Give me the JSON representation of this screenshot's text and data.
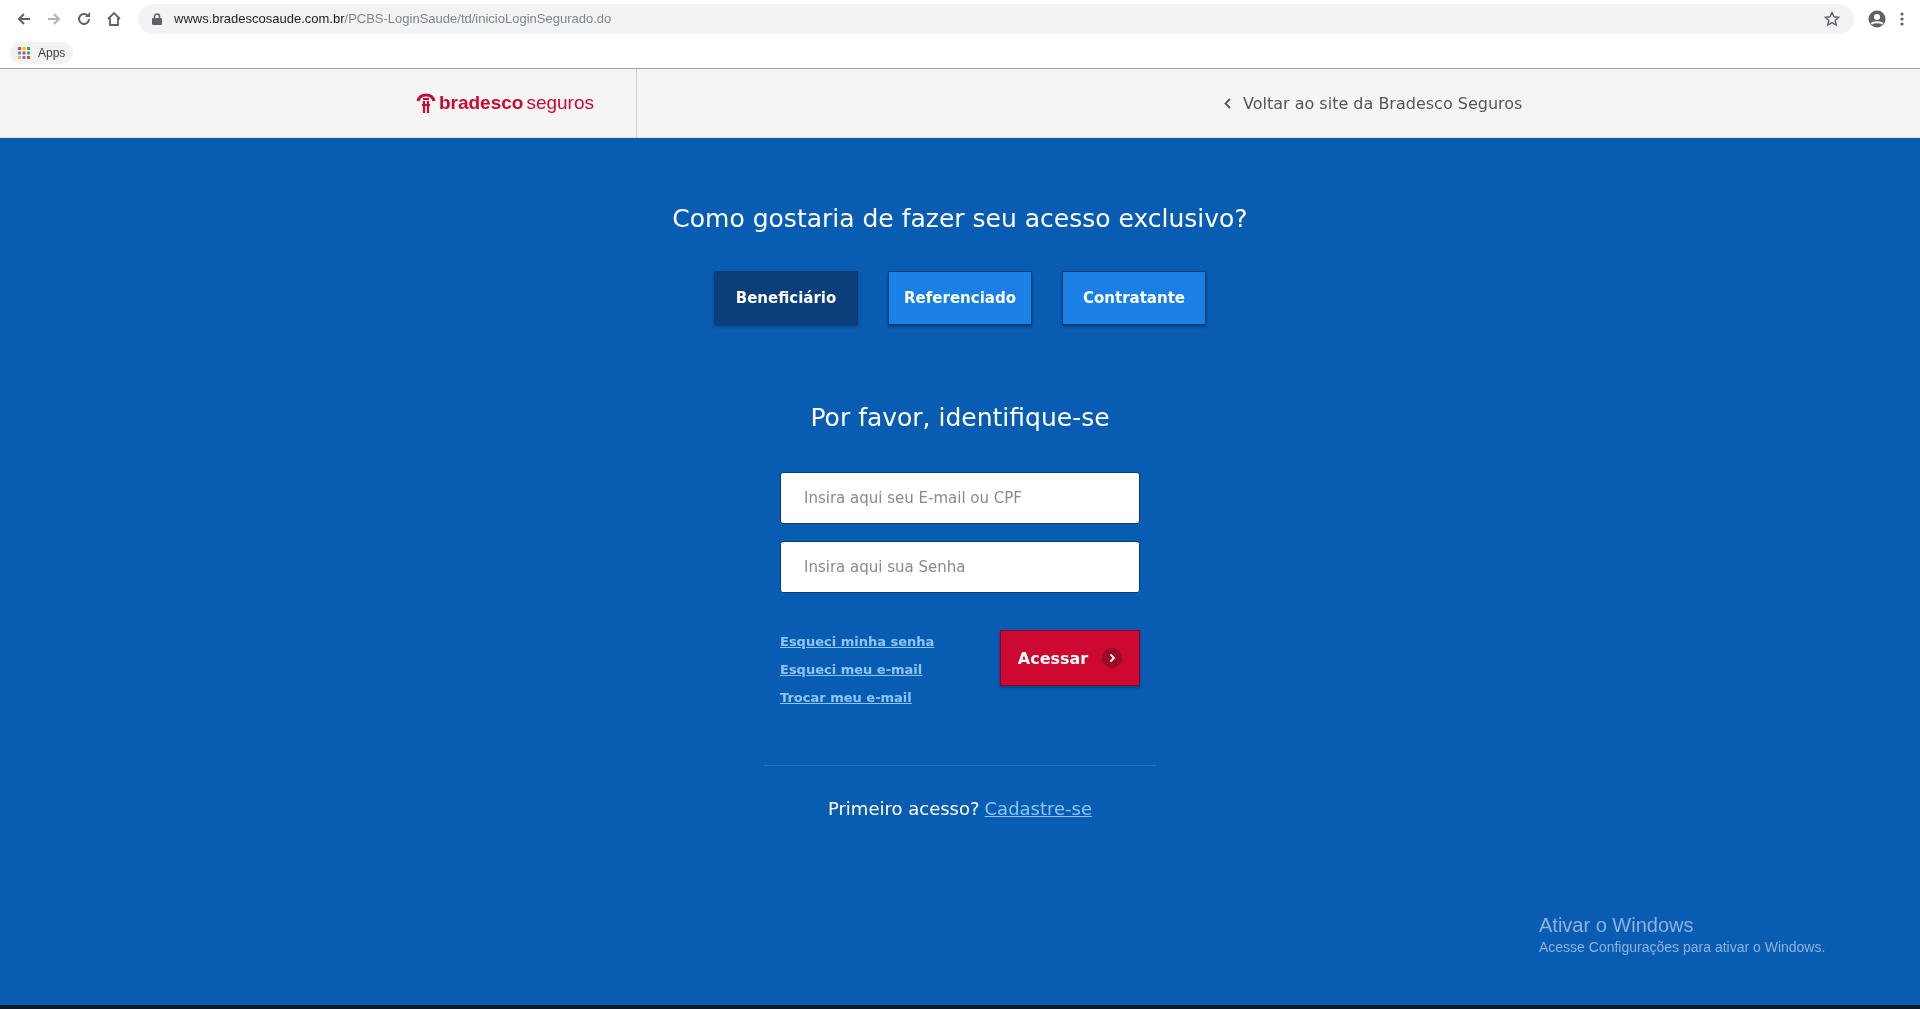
{
  "browser": {
    "url_host": "wwws.bradescosaude.com.br",
    "url_path": "/PCBS-LoginSaude/td/inicioLoginSegurado.do",
    "bookmarks": [
      "Apps"
    ]
  },
  "header": {
    "logo_bold": "bradesco",
    "logo_light": "seguros",
    "back_link": "Voltar ao site da Bradesco Seguros"
  },
  "access": {
    "title": "Como gostaria de fazer seu acesso exclusivo?",
    "tabs": [
      {
        "label": "Beneficiário",
        "selected": true
      },
      {
        "label": "Referenciado",
        "selected": false
      },
      {
        "label": "Contratante",
        "selected": false
      }
    ]
  },
  "login": {
    "title": "Por favor, identifique-se",
    "fields": [
      {
        "placeholder": "Insira aqui seu E-mail ou CPF"
      },
      {
        "placeholder": "Insira aqui sua Senha"
      }
    ],
    "links": [
      "Esqueci minha senha",
      "Esqueci meu e-mail",
      "Trocar meu e-mail"
    ],
    "submit": "Acessar",
    "first_access": "Primeiro acesso?",
    "register_link": "Cadastre-se"
  },
  "windows_notice": {
    "title": "Ativar o Windows",
    "text": "Acesse Configurações para ativar o Windows."
  }
}
